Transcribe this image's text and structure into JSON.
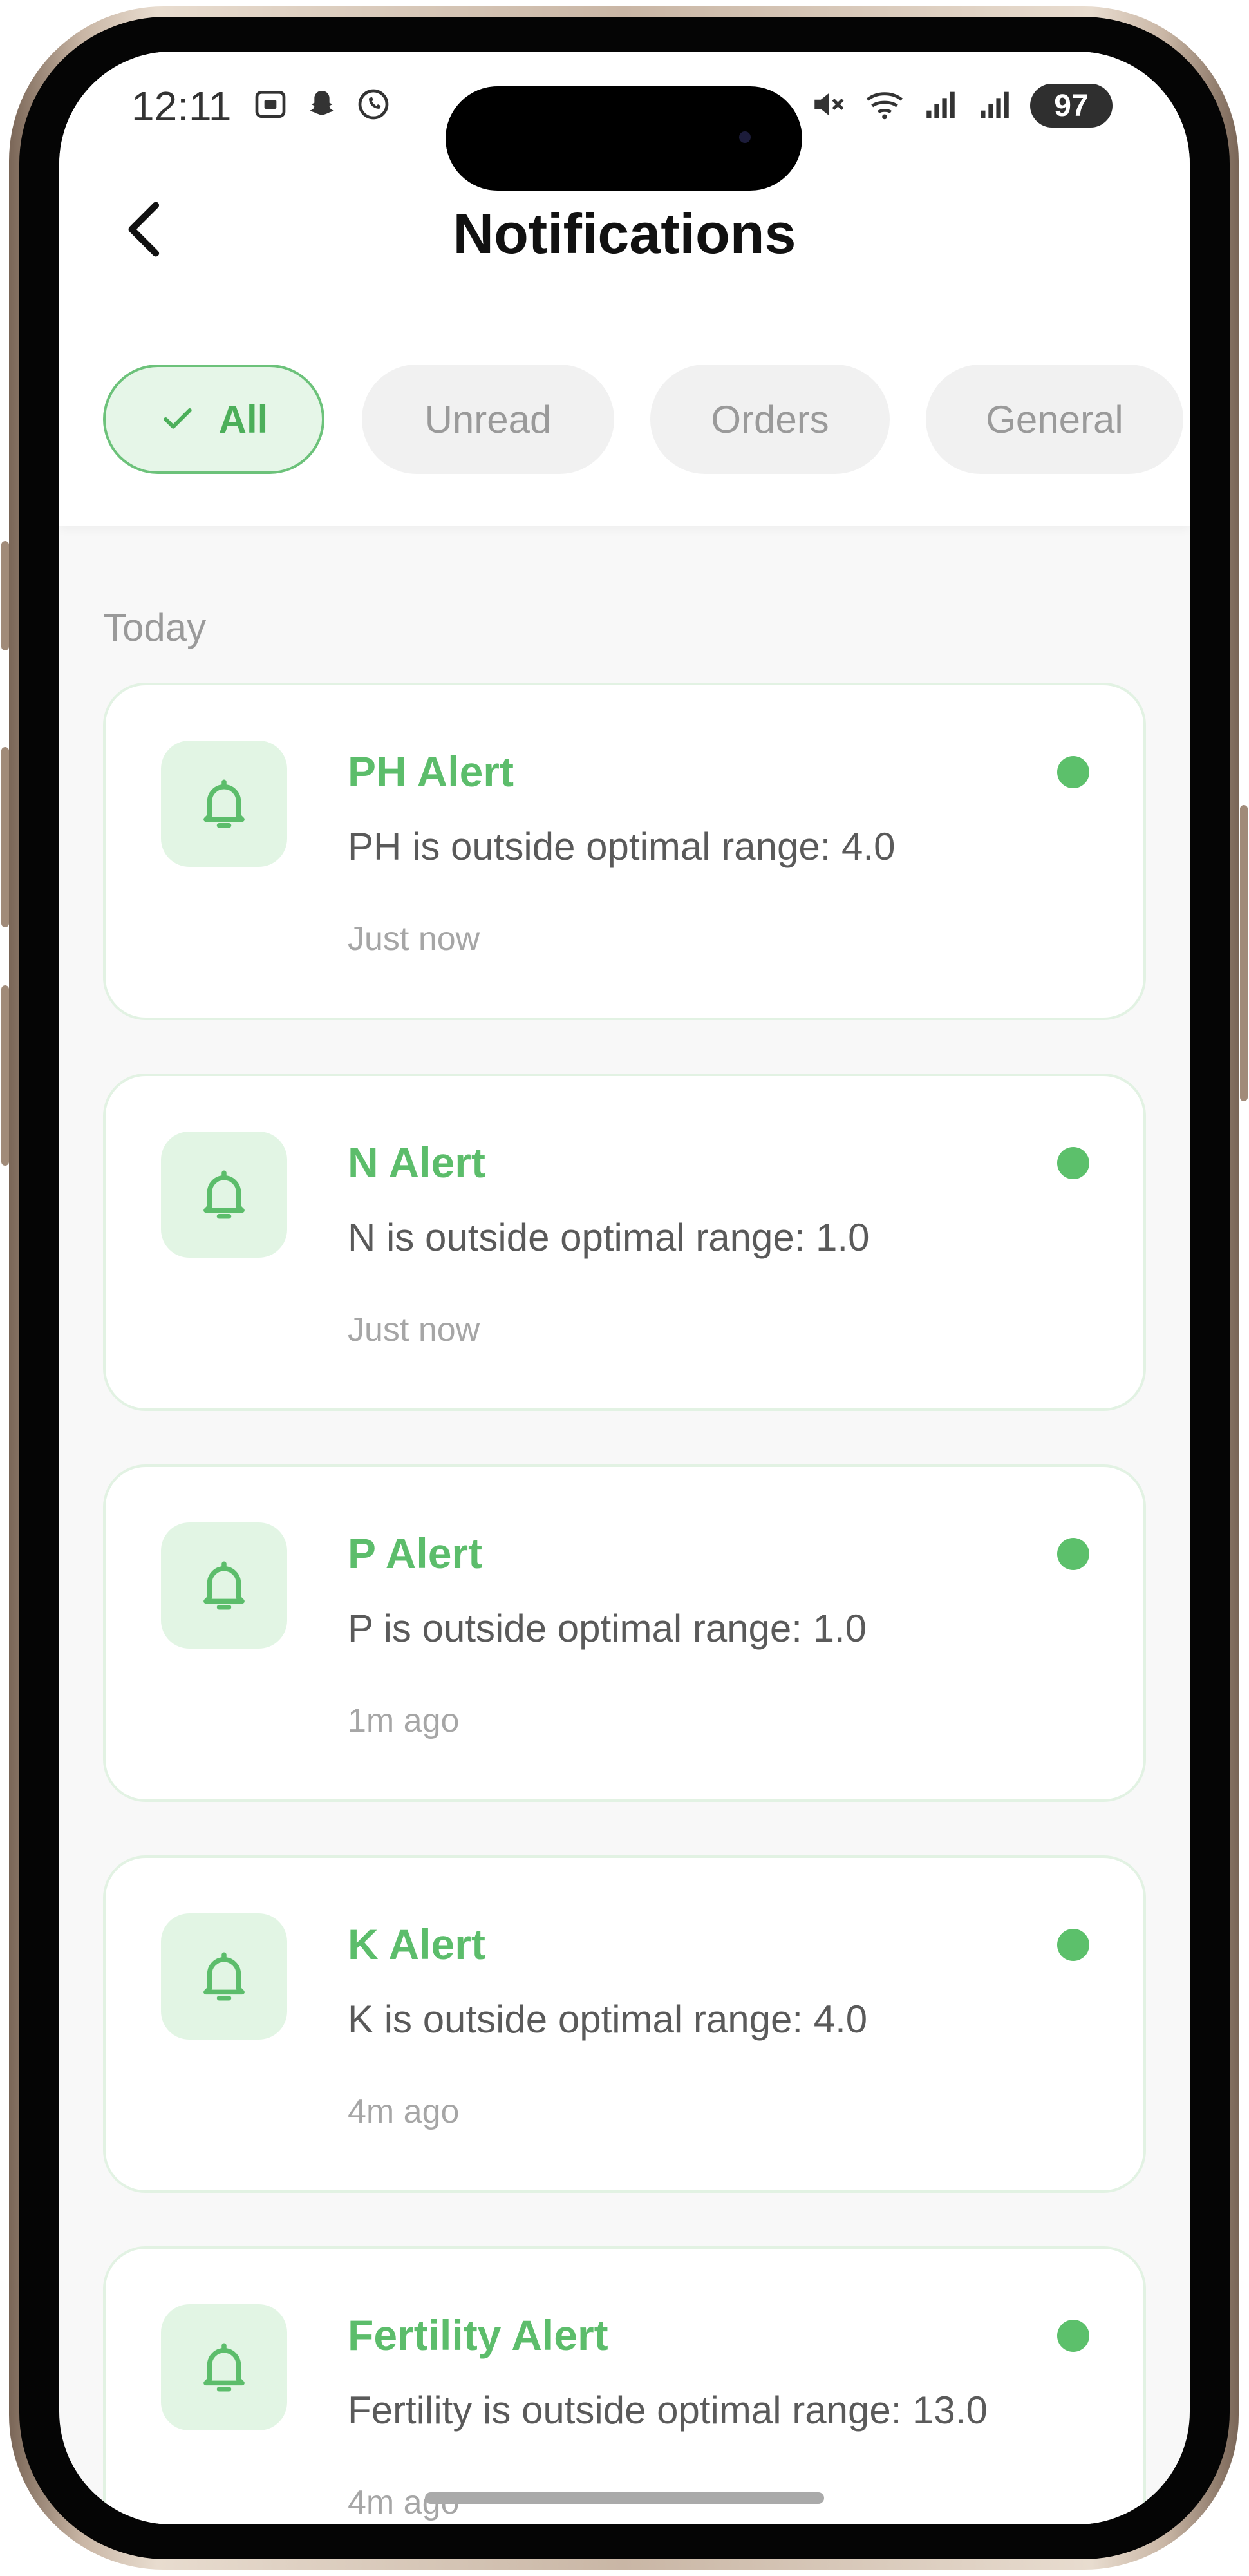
{
  "status_bar": {
    "time": "12:11",
    "app_icons": [
      "screenshot-icon",
      "snapchat-icon",
      "whatsapp-icon"
    ],
    "system_icons": [
      "mute-icon",
      "wifi-icon",
      "signal-icon",
      "signal-icon-2"
    ],
    "battery": "97"
  },
  "header": {
    "title": "Notifications"
  },
  "filters": [
    {
      "label": "All",
      "active": true
    },
    {
      "label": "Unread",
      "active": false
    },
    {
      "label": "Orders",
      "active": false
    },
    {
      "label": "General",
      "active": false
    }
  ],
  "section": {
    "label": "Today"
  },
  "notifications": [
    {
      "title": "PH Alert",
      "message": "PH is outside optimal range: 4.0",
      "time": "Just now",
      "unread": true
    },
    {
      "title": "N Alert",
      "message": "N is outside optimal range: 1.0",
      "time": "Just now",
      "unread": true
    },
    {
      "title": "P Alert",
      "message": "P is outside optimal range: 1.0",
      "time": "1m ago",
      "unread": true
    },
    {
      "title": "K Alert",
      "message": "K is outside optimal range: 4.0",
      "time": "4m ago",
      "unread": true
    },
    {
      "title": "Fertility Alert",
      "message": "Fertility is outside optimal range: 13.0",
      "time": "4m ago",
      "unread": true
    }
  ],
  "colors": {
    "accent": "#5cbd6b",
    "accent_bg": "#e2f5e4",
    "chip_bg": "#f1f1f1",
    "page_bg": "#f8f8f8"
  }
}
